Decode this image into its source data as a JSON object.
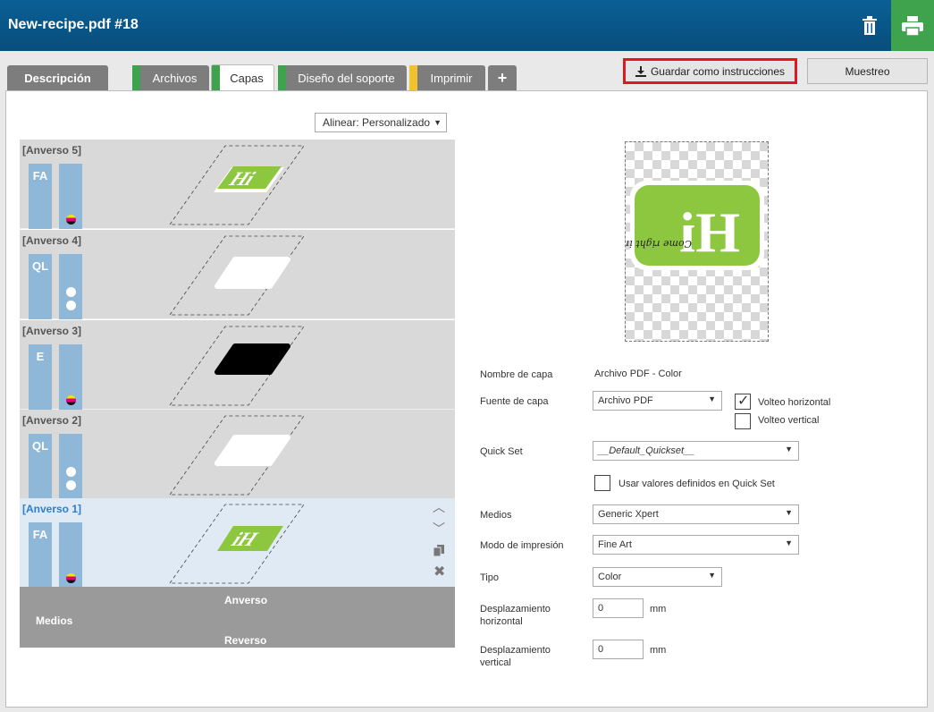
{
  "header": {
    "title": "New-recipe.pdf #18"
  },
  "tabs": {
    "descripcion": "Descripción",
    "archivos": "Archivos",
    "capas": "Capas",
    "diseno": "Diseño del soporte",
    "imprimir": "Imprimir",
    "add": "+"
  },
  "tab_colors": {
    "archivos": "#3fa34d",
    "capas": "#3fa34d",
    "diseno": "#3fa34d",
    "imprimir": "#f2c12e"
  },
  "toolbar": {
    "save_instructions": "Guardar como instrucciones",
    "sample": "Muestreo"
  },
  "align": {
    "label": "Alinear: Personalizado"
  },
  "layers": [
    {
      "name": "[Anverso 5]",
      "code": "FA"
    },
    {
      "name": "[Anverso 4]",
      "code": "QL"
    },
    {
      "name": "[Anverso 3]",
      "code": "E"
    },
    {
      "name": "[Anverso 2]",
      "code": "QL"
    },
    {
      "name": "[Anverso 1]",
      "code": "FA"
    }
  ],
  "media": {
    "label": "Medios",
    "front": "Anverso",
    "back": "Reverso"
  },
  "logo": {
    "text": "Hi",
    "handwriting": "Come right in!"
  },
  "props": {
    "layer_name_label": "Nombre de capa",
    "layer_name_value": "Archivo PDF - Color",
    "layer_source_label": "Fuente de capa",
    "layer_source_value": "Archivo PDF",
    "flip_h": "Volteo horizontal",
    "flip_h_checked": true,
    "flip_v": "Volteo vertical",
    "flip_v_checked": false,
    "quickset_label": "Quick Set",
    "quickset_value": "__Default_Quickset__",
    "use_quickset": "Usar valores definidos en Quick Set",
    "media_label": "Medios",
    "media_value": "Generic Xpert",
    "print_mode_label": "Modo de impresión",
    "print_mode_value": "Fine Art",
    "type_label": "Tipo",
    "type_value": "Color",
    "offset_h_label": "Desplazamiento horizontal",
    "offset_h_value": "0",
    "offset_v_label": "Desplazamiento vertical",
    "offset_v_value": "0",
    "unit": "mm"
  },
  "colors": {
    "header": "#0a5f96",
    "accent_green": "#3fa34d",
    "logo_green": "#8dc63f",
    "highlight_red": "#e0171e"
  }
}
